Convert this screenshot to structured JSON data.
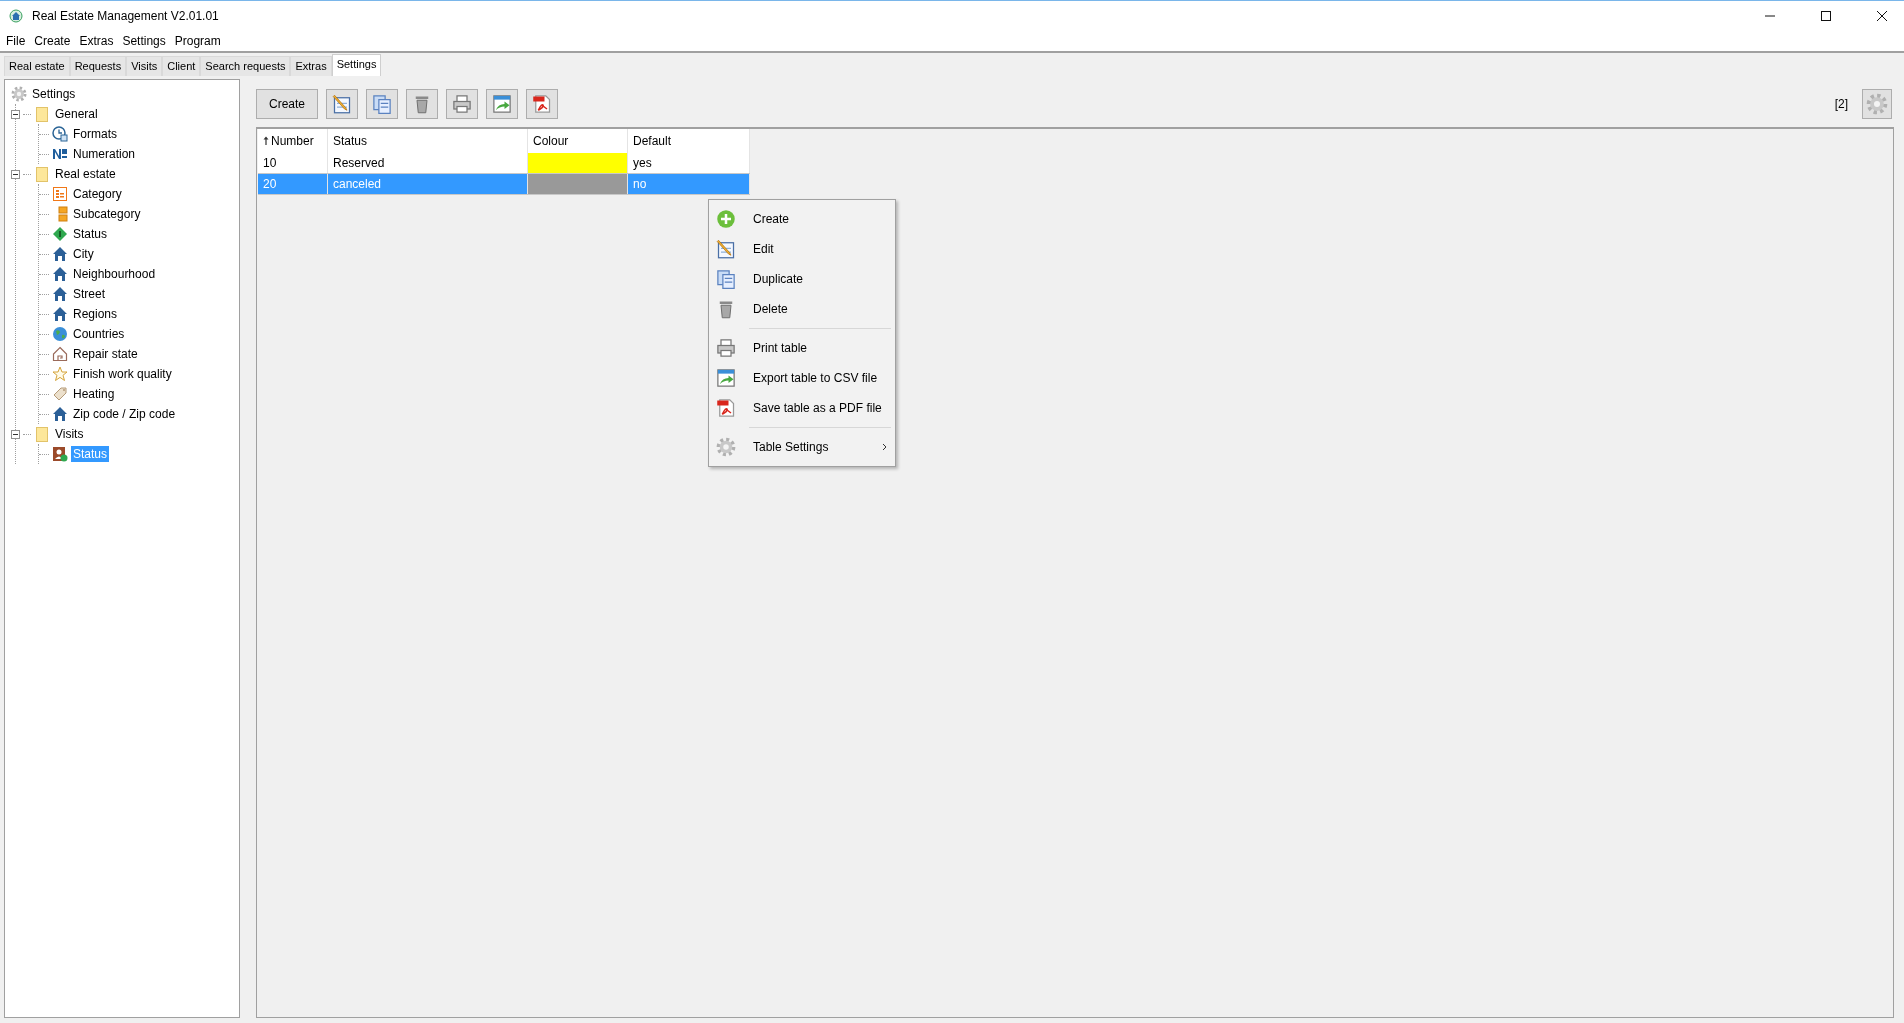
{
  "window": {
    "title": "Real Estate Management V2.01.01"
  },
  "menu": [
    "File",
    "Create",
    "Extras",
    "Settings",
    "Program"
  ],
  "tabs": [
    {
      "label": "Real estate",
      "selected": false
    },
    {
      "label": "Requests",
      "selected": false
    },
    {
      "label": "Visits",
      "selected": false
    },
    {
      "label": "Client",
      "selected": false
    },
    {
      "label": "Search requests",
      "selected": false
    },
    {
      "label": "Extras",
      "selected": false
    },
    {
      "label": "Settings",
      "selected": true
    }
  ],
  "tree": {
    "label": "Settings",
    "kind": "gear",
    "selected": false,
    "children": [
      {
        "label": "General",
        "kind": "folder",
        "expanded": true,
        "selected": false,
        "children": [
          {
            "label": "Formats",
            "kind": "clock",
            "selected": false
          },
          {
            "label": "Numeration",
            "kind": "number",
            "selected": false
          }
        ]
      },
      {
        "label": "Real estate",
        "kind": "folder",
        "expanded": true,
        "selected": false,
        "children": [
          {
            "label": "Category",
            "kind": "category",
            "selected": false
          },
          {
            "label": "Subcategory",
            "kind": "subcategory",
            "selected": false
          },
          {
            "label": "Status",
            "kind": "diamond",
            "selected": false
          },
          {
            "label": "City",
            "kind": "house",
            "selected": false
          },
          {
            "label": "Neighbourhood",
            "kind": "house",
            "selected": false
          },
          {
            "label": "Street",
            "kind": "house",
            "selected": false
          },
          {
            "label": "Regions",
            "kind": "house",
            "selected": false
          },
          {
            "label": "Countries",
            "kind": "globe",
            "selected": false
          },
          {
            "label": "Repair state",
            "kind": "house-outline",
            "selected": false
          },
          {
            "label": "Finish work quality",
            "kind": "star",
            "selected": false
          },
          {
            "label": "Heating",
            "kind": "tag",
            "selected": false
          },
          {
            "label": "Zip code / Zip code",
            "kind": "house",
            "selected": false
          }
        ]
      },
      {
        "label": "Visits",
        "kind": "folder",
        "expanded": true,
        "selected": false,
        "children": [
          {
            "label": "Status",
            "kind": "person",
            "selected": true
          }
        ]
      }
    ]
  },
  "toolbar": {
    "create_label": "Create",
    "buttons": [
      {
        "kind": "edit"
      },
      {
        "kind": "duplicate"
      },
      {
        "kind": "delete"
      },
      {
        "kind": "print"
      },
      {
        "kind": "export"
      },
      {
        "kind": "pdf"
      }
    ],
    "count": "[2]"
  },
  "table": {
    "columns": [
      {
        "label": "Number",
        "sorted": true
      },
      {
        "label": "Status",
        "sorted": false
      },
      {
        "label": "Colour",
        "sorted": false
      },
      {
        "label": "Default",
        "sorted": false
      }
    ],
    "rows": [
      {
        "number": "10",
        "status": "Reserved",
        "color": "#ffff00",
        "default": "yes",
        "selected": false
      },
      {
        "number": "20",
        "status": "canceled",
        "color": "#999999",
        "default": "no",
        "selected": true
      }
    ]
  },
  "context_menu": {
    "groups": [
      [
        {
          "label": "Create",
          "kind": "create",
          "has_submenu": false
        },
        {
          "label": "Edit",
          "kind": "edit",
          "has_submenu": false
        },
        {
          "label": "Duplicate",
          "kind": "duplicate",
          "has_submenu": false
        },
        {
          "label": "Delete",
          "kind": "delete",
          "has_submenu": false
        }
      ],
      [
        {
          "label": "Print table",
          "kind": "print",
          "has_submenu": false
        },
        {
          "label": "Export table to CSV file",
          "kind": "export",
          "has_submenu": false
        },
        {
          "label": "Save table as a PDF file",
          "kind": "pdf",
          "has_submenu": false
        }
      ],
      [
        {
          "label": "Table Settings",
          "kind": "gear",
          "has_submenu": true
        }
      ]
    ]
  }
}
